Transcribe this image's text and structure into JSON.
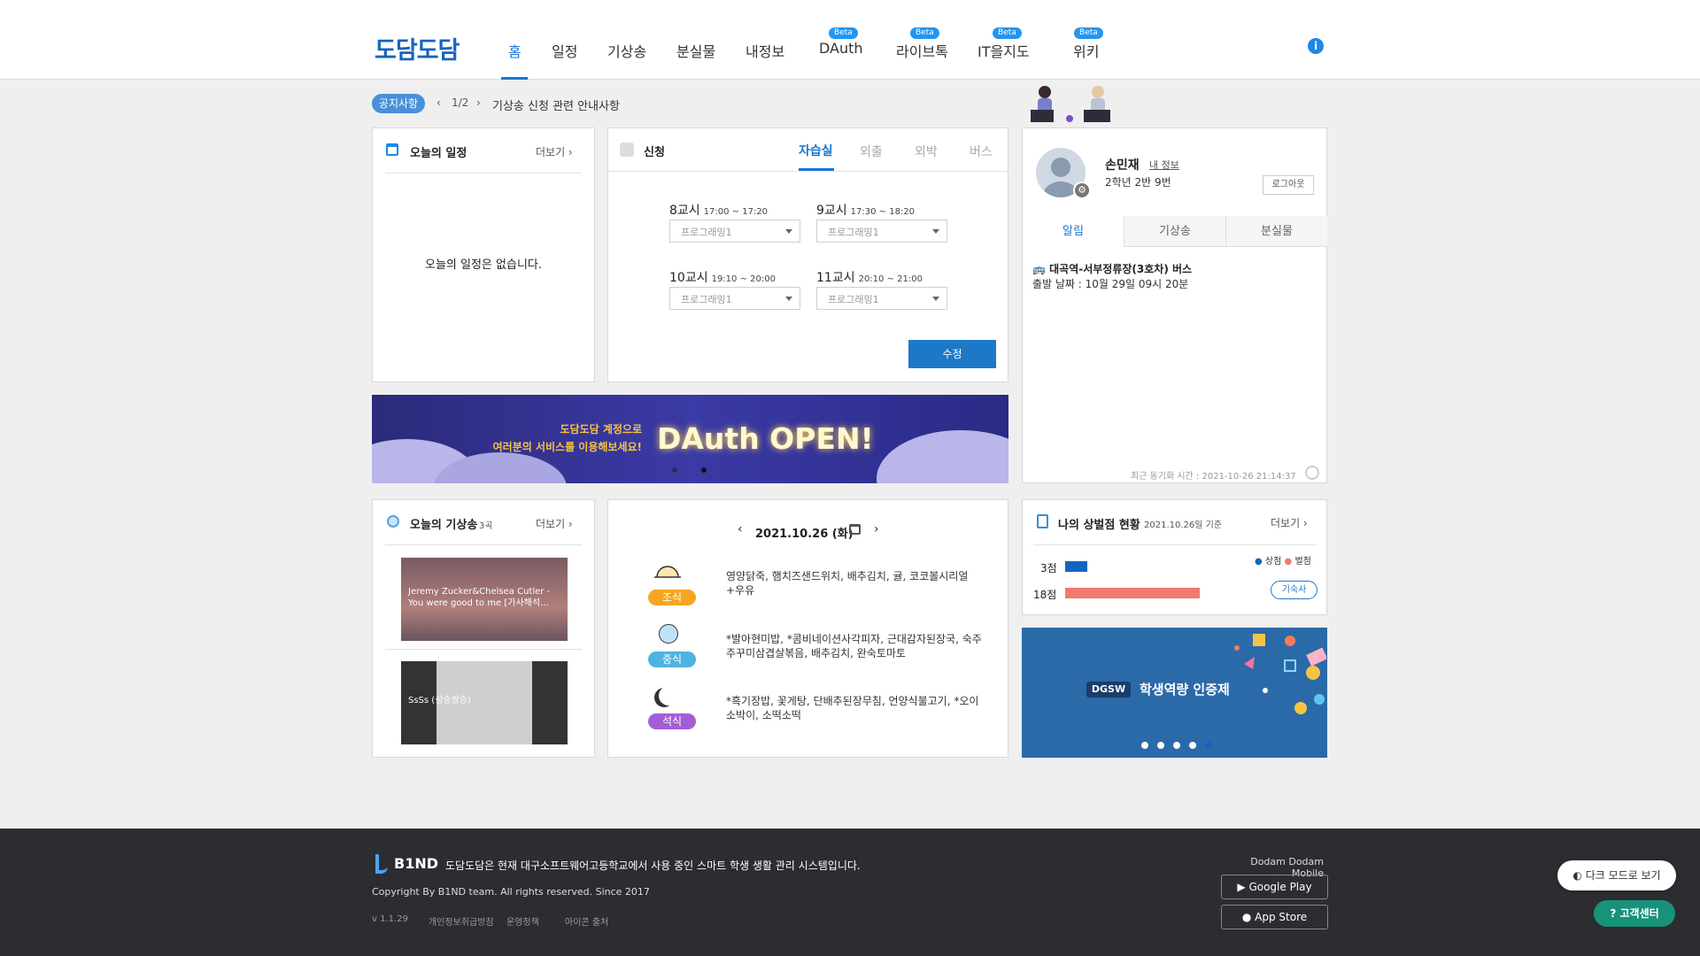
{
  "header": {
    "logo": "도담도담",
    "nav": [
      {
        "label": "홈",
        "beta": "",
        "active": true
      },
      {
        "label": "일정",
        "beta": ""
      },
      {
        "label": "기상송",
        "beta": ""
      },
      {
        "label": "분실물",
        "beta": ""
      },
      {
        "label": "내정보",
        "beta": ""
      },
      {
        "label": "DAuth",
        "beta": "Beta"
      },
      {
        "label": "라이브톡",
        "beta": "Beta"
      },
      {
        "label": "IT을지도",
        "beta": "Beta"
      },
      {
        "label": "위키",
        "beta": "Beta"
      }
    ],
    "info": "i"
  },
  "notice": {
    "badge": "공지사항",
    "page": "1/2",
    "prev": "‹",
    "next": "›",
    "title": "기상송 신청 관련 안내사항"
  },
  "schedule": {
    "title": "오늘의 일정",
    "more": "더보기 ›",
    "empty": "오늘의 일정은 없습니다."
  },
  "apply": {
    "title": "신청",
    "tabs": [
      "자습실",
      "외출",
      "외박",
      "버스"
    ],
    "periods": [
      {
        "name": "8교시",
        "time": "17:00 ~ 17:20",
        "value": "프로그래밍1"
      },
      {
        "name": "9교시",
        "time": "17:30 ~ 18:20",
        "value": "프로그래밍1"
      },
      {
        "name": "10교시",
        "time": "19:10 ~ 20:00",
        "value": "프로그래밍1"
      },
      {
        "name": "11교시",
        "time": "20:10 ~ 21:00",
        "value": "프로그래밍1"
      }
    ],
    "submit": "수정"
  },
  "banner": {
    "line1": "도담도담 계정으로",
    "line2": "여러분의 서비스를 이용해보세요!",
    "headline": "DAuth OPEN!"
  },
  "profile": {
    "name": "손민재",
    "myinfo": "내 정보",
    "class": "2학년 2반 9번",
    "logout": "로그아웃",
    "tabs": [
      "알림",
      "기상송",
      "분실물"
    ],
    "notification_title": "대곡역-서부정류장(3호차) 버스",
    "notification_body": "출발 날짜 : 10월 29일 09시 20분",
    "sync": "최근 동기화 시간 : 2021-10-26 21:14:37"
  },
  "songs": {
    "title": "오늘의 기상송",
    "count": "3곡",
    "more": "더보기 ›",
    "items": [
      {
        "title": "Jeremy Zucker&Chelsea Cutler - You were good to me [가사해석…"
      },
      {
        "title": "SsSs (상승쌍승)"
      }
    ]
  },
  "meals": {
    "date": "2021.10.26 (화)",
    "prev": "‹",
    "next": "›",
    "items": [
      {
        "label": "조식",
        "color": "#f5a623",
        "menu": "영양닭죽, 햄치즈샌드위치, 배추김치, 귤, 코코볼시리얼+우유"
      },
      {
        "label": "중식",
        "color": "#4fb3e0",
        "menu": "*발아현미밥, *콤비네이션사각피자, 근대감자된장국, 숙주주꾸미삼겹살볶음, 배추김치, 완숙토마토"
      },
      {
        "label": "석식",
        "color": "#a35ed6",
        "menu": "*흑기장밥, 꽃게탕, 단배추된장무침, 언양식불고기, *오이소박이, 소떡소떡"
      }
    ]
  },
  "points": {
    "title": "나의 상벌점 현황",
    "date": "2021.10.26일 기준",
    "more": "더보기 ›",
    "legend_merit": "상점",
    "legend_demerit": "벌점",
    "merit_label": "3점",
    "demerit_label": "18점",
    "merit": 3,
    "demerit": 18,
    "dorm": "기숙사"
  },
  "promo": {
    "logo": "DGSW",
    "text": "학생역량 인증제"
  },
  "footer": {
    "brand": "B1ND",
    "desc": "도담도담은 현재 대구소프트웨어고등학교에서 사용 중인 스마트 학생 생활 관리 시스템입니다.",
    "copyright": "Copyright By B1ND team. All rights reserved. Since 2017",
    "version": "v 1.1.29",
    "links": [
      "개인정보취급방침",
      "운영정책",
      "아이콘 출처"
    ],
    "mobile": "Dodam Dodam Mobile",
    "google": "Google Play",
    "apple": "App Store"
  },
  "floating": {
    "dark": "다크 모드로 보기",
    "help": "고객센터"
  }
}
